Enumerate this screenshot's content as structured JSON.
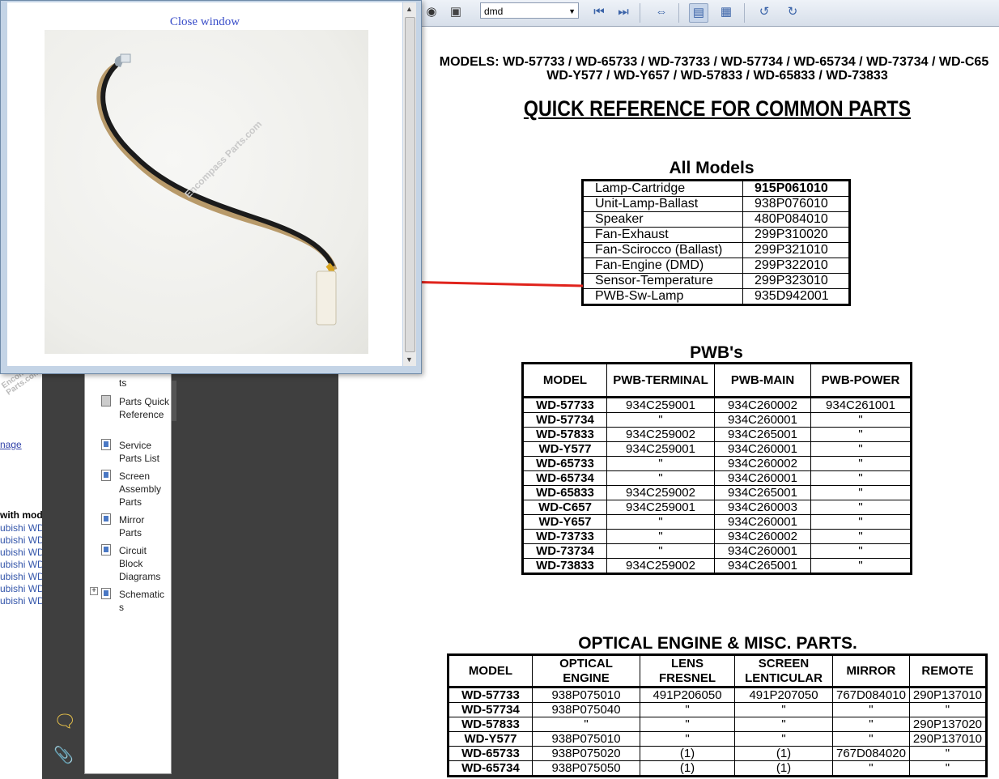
{
  "background_page": {
    "watermark": "Encompass Parts.com",
    "image_link": "nage",
    "with_models": "with mod",
    "links": [
      "ubishi WD",
      "ubishi WD",
      "ubishi WD",
      "ubishi WD",
      "ubishi WD",
      "ubishi WD",
      "ubishi WD"
    ]
  },
  "toolbar": {
    "zoom_value": "dmd"
  },
  "bookmarks": {
    "items": [
      {
        "label": "ts"
      },
      {
        "label": "Parts Quick Reference"
      },
      {
        "label": "Service Parts List"
      },
      {
        "label": "Screen Assembly Parts"
      },
      {
        "label": "Mirror Parts"
      },
      {
        "label": "Circuit Block Diagrams"
      },
      {
        "label": "Schematics"
      }
    ]
  },
  "popup": {
    "close_label": "Close window",
    "photo_watermark": "Encompass Parts.com"
  },
  "pdf": {
    "models_line1": "MODELS: WD-57733 / WD-65733 / WD-73733 / WD-57734 / WD-65734 / WD-73734 / WD-C65",
    "models_line2": "WD-Y577 / WD-Y657 / WD-57833 / WD-65833 / WD-73833",
    "title": "QUICK REFERENCE FOR COMMON PARTS",
    "all_models": {
      "heading": "All Models",
      "rows": [
        [
          "Lamp-Cartridge",
          "915P061010"
        ],
        [
          "Unit-Lamp-Ballast",
          "938P076010"
        ],
        [
          "Speaker",
          "480P084010"
        ],
        [
          "Fan-Exhaust",
          "299P310020"
        ],
        [
          "Fan-Scirocco (Ballast)",
          "299P321010"
        ],
        [
          "Fan-Engine (DMD)",
          "299P322010"
        ],
        [
          "Sensor-Temperature",
          "299P323010"
        ],
        [
          "PWB-Sw-Lamp",
          "935D942001"
        ]
      ]
    },
    "pwbs": {
      "heading": "PWB's",
      "columns": [
        "MODEL",
        "PWB-TERMINAL",
        "PWB-MAIN",
        "PWB-POWER"
      ],
      "rows": [
        [
          "WD-57733",
          "934C259001",
          "934C260002",
          "934C261001"
        ],
        [
          "WD-57734",
          "\"",
          "934C260001",
          "\""
        ],
        [
          "WD-57833",
          "934C259002",
          "934C265001",
          "\""
        ],
        [
          "WD-Y577",
          "934C259001",
          "934C260001",
          "\""
        ],
        [
          "WD-65733",
          "\"",
          "934C260002",
          "\""
        ],
        [
          "WD-65734",
          "\"",
          "934C260001",
          "\""
        ],
        [
          "WD-65833",
          "934C259002",
          "934C265001",
          "\""
        ],
        [
          "WD-C657",
          "934C259001",
          "934C260003",
          "\""
        ],
        [
          "WD-Y657",
          "\"",
          "934C260001",
          "\""
        ],
        [
          "WD-73733",
          "\"",
          "934C260002",
          "\""
        ],
        [
          "WD-73734",
          "\"",
          "934C260001",
          "\""
        ],
        [
          "WD-73833",
          "934C259002",
          "934C265001",
          "\""
        ]
      ]
    },
    "optical": {
      "heading": "OPTICAL ENGINE & MISC. PARTS.",
      "columns": [
        "MODEL",
        "OPTICAL ENGINE",
        "LENS FRESNEL",
        "SCREEN LENTICULAR",
        "MIRROR",
        "REMOTE"
      ],
      "rows": [
        [
          "WD-57733",
          "938P075010",
          "491P206050",
          "491P207050",
          "767D084010",
          "290P137010"
        ],
        [
          "WD-57734",
          "938P075040",
          "\"",
          "\"",
          "\"",
          "\""
        ],
        [
          "WD-57833",
          "\"",
          "\"",
          "\"",
          "\"",
          "290P137020"
        ],
        [
          "WD-Y577",
          "938P075010",
          "\"",
          "\"",
          "\"",
          "290P137010"
        ],
        [
          "WD-65733",
          "938P075020",
          "(1)",
          "(1)",
          "767D084020",
          "\""
        ],
        [
          "WD-65734",
          "938P075050",
          "(1)",
          "(1)",
          "\"",
          "\""
        ]
      ]
    }
  },
  "colors": {
    "acrobat_panel": "#3f3f3f",
    "popup_frame": "#c4d4e6",
    "arrow": "#e0231c",
    "link": "#3a4ec9"
  }
}
